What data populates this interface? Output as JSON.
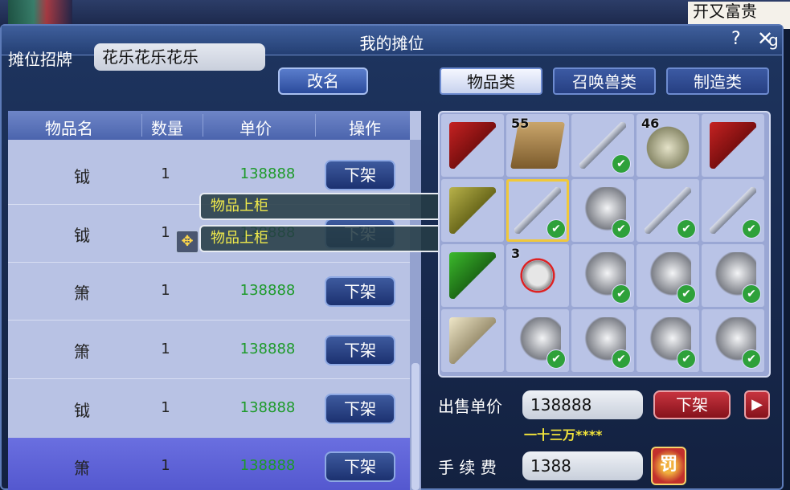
{
  "background": {
    "right_text": "开又富贵",
    "right_g": "g"
  },
  "window": {
    "title": "我的摊位",
    "help": "?",
    "close": "✕"
  },
  "signboard": {
    "label": "摊位招牌",
    "value": "花乐花乐花乐",
    "rename_button": "改名"
  },
  "tabs": [
    {
      "label": "物品类",
      "active": true
    },
    {
      "label": "召唤兽类",
      "active": false
    },
    {
      "label": "制造类",
      "active": false
    }
  ],
  "list": {
    "headers": [
      "物品名",
      "数量",
      "单价",
      "操作"
    ],
    "rows": [
      {
        "name": "钺",
        "qty": "1",
        "price": "138888",
        "action": "下架",
        "selected": false
      },
      {
        "name": "钺",
        "qty": "1",
        "price": "138888",
        "action": "下架",
        "selected": false
      },
      {
        "name": "箫",
        "qty": "1",
        "price": "138888",
        "action": "下架",
        "selected": false
      },
      {
        "name": "箫",
        "qty": "1",
        "price": "138888",
        "action": "下架",
        "selected": false
      },
      {
        "name": "钺",
        "qty": "1",
        "price": "138888",
        "action": "下架",
        "selected": false
      },
      {
        "name": "箫",
        "qty": "1",
        "price": "138888",
        "action": "下架",
        "selected": true
      }
    ]
  },
  "tooltips": [
    "物品上柜",
    "物品上柜"
  ],
  "inventory": [
    {
      "icon": "red-flag",
      "count": "",
      "listed": false
    },
    {
      "icon": "book",
      "count": "55",
      "listed": false
    },
    {
      "icon": "flute",
      "count": "",
      "listed": true
    },
    {
      "icon": "shell",
      "count": "46",
      "listed": false
    },
    {
      "icon": "red-flag",
      "count": "",
      "listed": false
    },
    {
      "icon": "yellow-flag",
      "count": "",
      "listed": false
    },
    {
      "icon": "flute",
      "count": "",
      "listed": true,
      "highlight": true
    },
    {
      "icon": "bell",
      "count": "",
      "listed": true
    },
    {
      "icon": "flute",
      "count": "",
      "listed": true
    },
    {
      "icon": "flute",
      "count": "",
      "listed": true
    },
    {
      "icon": "green-flag",
      "count": "",
      "listed": false
    },
    {
      "icon": "box",
      "count": "3",
      "listed": false
    },
    {
      "icon": "bell",
      "count": "",
      "listed": true
    },
    {
      "icon": "bell",
      "count": "",
      "listed": true
    },
    {
      "icon": "bell",
      "count": "",
      "listed": true
    },
    {
      "icon": "white-flag",
      "count": "",
      "listed": false
    },
    {
      "icon": "bell",
      "count": "",
      "listed": true
    },
    {
      "icon": "bell",
      "count": "",
      "listed": true
    },
    {
      "icon": "bell",
      "count": "",
      "listed": true
    },
    {
      "icon": "bell",
      "count": "",
      "listed": true
    }
  ],
  "sell": {
    "price_label": "出售单价",
    "price_value": "138888",
    "price_in_words": "一十三万****",
    "delist_button": "下架",
    "next_button": "▶",
    "fee_label": "手 续 费",
    "fee_value": "1388",
    "fee_badge": "罚"
  }
}
